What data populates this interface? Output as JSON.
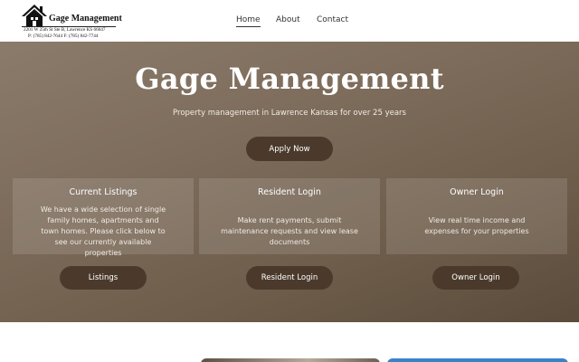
{
  "logo": {
    "name": "Gage Management",
    "address": "2201 W 25th St Ste B, Lawrence KS 66047",
    "phones": "P: (785) 842-7644     F: (785) 842-7744",
    "icon": "house-icon"
  },
  "nav": {
    "items": [
      {
        "label": "Home",
        "active": true
      },
      {
        "label": "About",
        "active": false
      },
      {
        "label": "Contact",
        "active": false
      }
    ]
  },
  "hero": {
    "title": "Gage Management",
    "subtitle": "Property management in Lawrence Kansas for over 25 years",
    "apply_label": "Apply Now"
  },
  "cards": [
    {
      "title": "Current Listings",
      "text": "We have a wide selection of single family homes, apartments and town homes. Please click below to see our currently available properties",
      "button": "Listings"
    },
    {
      "title": "Resident Login",
      "text": "Make rent payments, submit maintenance requests and view lease documents",
      "button": "Resident Login"
    },
    {
      "title": "Owner Login",
      "text": "View real time income and expenses for your properties",
      "button": "Owner Login"
    }
  ],
  "colors": {
    "button_bg": "#4b3a2c",
    "hero_bg": "#7e6d5c",
    "accent_blue": "#3d82c7"
  }
}
